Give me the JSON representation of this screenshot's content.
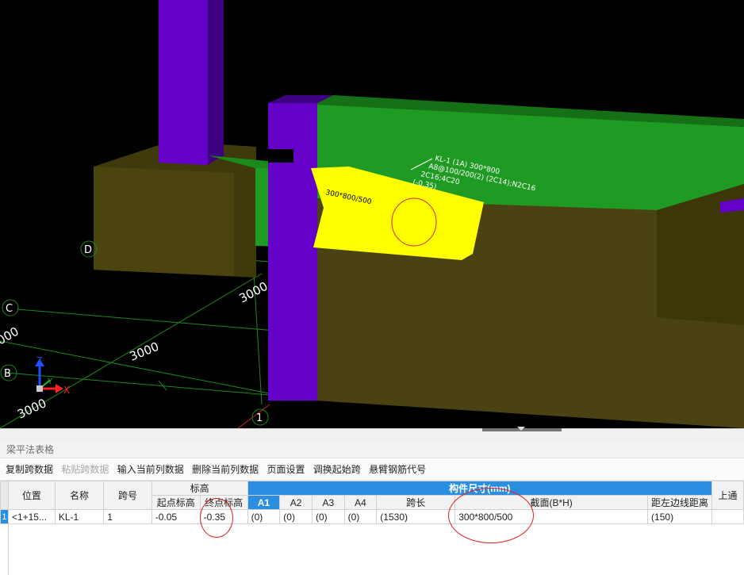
{
  "viewport": {
    "grid_axes": [
      "D",
      "C",
      "B",
      "1"
    ],
    "dimensions": [
      "3000",
      "3000",
      "3000",
      "000"
    ],
    "beam_annotation_lines": [
      "KL-1 (1A) 300*800",
      "A8@100/200(2) (2C14);N2C16",
      "2C16;4C20",
      "(-0.35)"
    ],
    "span_label": "300*800/500",
    "axis_x": "X",
    "axis_y": "Y",
    "axis_z": "Z",
    "colors": {
      "background": "#000000",
      "column": "#6400c8",
      "beam": "#1f9a22",
      "selected_beam": "#ffff00",
      "slab": "#4a4212",
      "grid": "#1a8a1a",
      "highlight_ellipse": "#e02020"
    }
  },
  "panel": {
    "title": "梁平法表格"
  },
  "toolbar": {
    "copy_span": "复制跨数据",
    "paste_span": "粘贴跨数据",
    "input_column": "输入当前列数据",
    "delete_column": "删除当前列数据",
    "page_setup": "页面设置",
    "swap_start_span": "调换起始跨",
    "cantilever_code": "悬臂钢筋代号"
  },
  "table": {
    "headers": {
      "position": "位置",
      "name": "名称",
      "span_no": "跨号",
      "elevation": "标高",
      "start_elev": "起点标高",
      "end_elev": "终点标高",
      "member_size": "构件尺寸(mm)",
      "a1": "A1",
      "a2": "A2",
      "a3": "A3",
      "a4": "A4",
      "span_len": "跨长",
      "section": "截面(B*H)",
      "edge_dist": "距左边线距离",
      "more": "上通"
    },
    "rows": [
      {
        "row_no": "1",
        "position": "<1+15...",
        "name": "KL-1",
        "span_no": "1",
        "start_elev": "-0.05",
        "end_elev": "-0.35",
        "a1": "(0)",
        "a2": "(0)",
        "a3": "(0)",
        "a4": "(0)",
        "span_len": "(1530)",
        "section": "300*800/500",
        "edge_dist": "(150)"
      }
    ]
  }
}
